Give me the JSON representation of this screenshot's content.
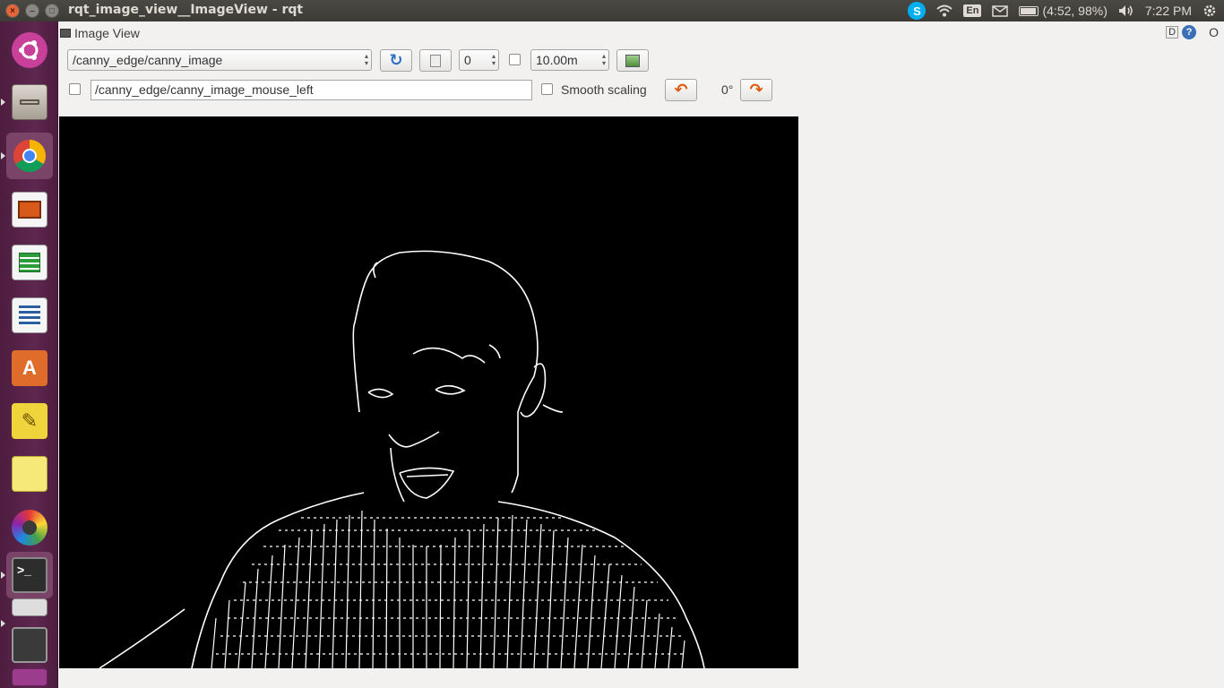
{
  "window": {
    "title": "rqt_image_view__ImageView - rqt",
    "close_label": "×",
    "minimize_label": "–",
    "maximize_label": "□"
  },
  "indicators": {
    "skype": "S",
    "language": "En",
    "battery": "(4:52, 98%)",
    "clock": "7:22 PM"
  },
  "launcher": {
    "items": [
      "dash",
      "files",
      "chrome",
      "impress",
      "calc",
      "writer",
      "software-center",
      "text-editor",
      "sticky-notes",
      "color-picker",
      "terminal",
      "screenshot",
      "workspace"
    ]
  },
  "dock": {
    "title": "Image View",
    "d_label": "D",
    "help_label": "?",
    "close_label": "O"
  },
  "toolbar": {
    "topic_value": "/canny_edge/canny_image",
    "refresh_icon": "↻",
    "zoom_value": "0",
    "rate_value": "10.00m",
    "mouse_topic_value": "/canny_edge/canny_image_mouse_left",
    "smooth_label": "Smooth scaling",
    "rotation_value": "0°",
    "rotate_left_icon": "↶",
    "rotate_right_icon": "↷"
  },
  "colors": {
    "accent_orange": "#e05a0c",
    "refresh_blue": "#2f6fc4",
    "launcher_bg": "#5e2750"
  }
}
